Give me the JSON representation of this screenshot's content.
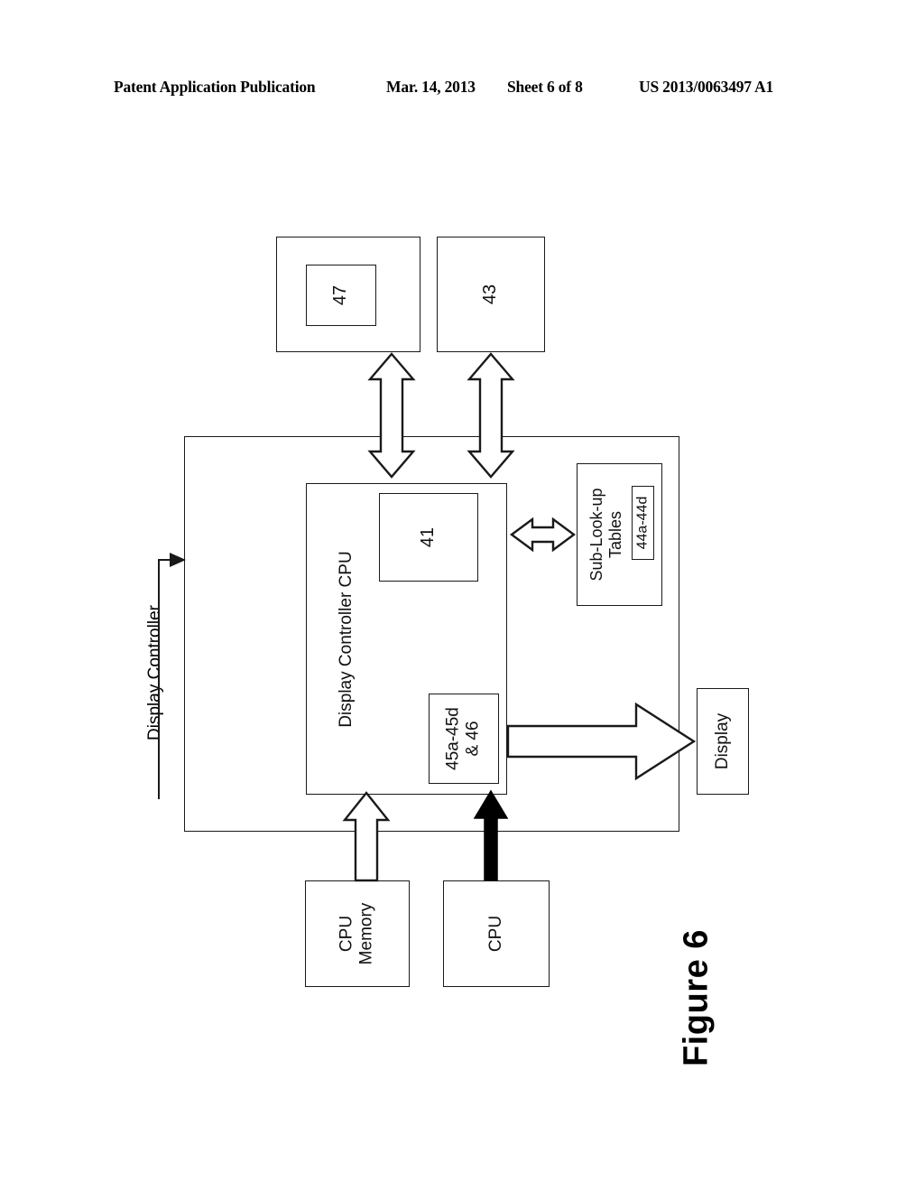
{
  "header": {
    "publication": "Patent Application Publication",
    "date": "Mar. 14, 2013",
    "sheet": "Sheet 6 of 8",
    "patent_number": "US 2013/0063497 A1"
  },
  "figure": {
    "caption": "Figure 6"
  },
  "diagram": {
    "outer_label": "Display Controller",
    "boxes": {
      "box_47_outer": "",
      "box_47_inner": "47",
      "box_43": "43",
      "display_controller_cpu": "Display Controller CPU",
      "block_41": "41",
      "block_45": "45a-45d\n& 46",
      "sub_lookup_tables": "Sub-Look-up\nTables",
      "block_44": "44a-44d",
      "display": "Display",
      "cpu_memory": "CPU\nMemory",
      "cpu": "CPU"
    }
  },
  "colors": {
    "line": "#1a1a1a",
    "fill": "#ffffff",
    "solid_arrow": "#000000"
  }
}
